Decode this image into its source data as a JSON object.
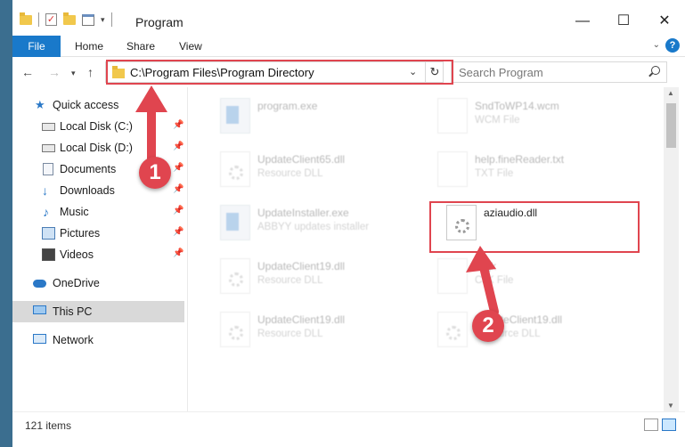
{
  "window": {
    "title": "Program"
  },
  "ribbon": {
    "tabs": [
      "File",
      "Home",
      "Share",
      "View"
    ],
    "help": "?"
  },
  "address": {
    "path": "C:\\Program Files\\Program Directory",
    "search_placeholder": "Search Program"
  },
  "nav": {
    "items": [
      {
        "label": "Quick access",
        "icon": "star-icon"
      },
      {
        "label": "Local Disk (C:)",
        "icon": "disk-icon",
        "pinned": true
      },
      {
        "label": "Local Disk (D:)",
        "icon": "disk-icon",
        "pinned": true
      },
      {
        "label": "Documents",
        "icon": "documents-icon",
        "pinned": true
      },
      {
        "label": "Downloads",
        "icon": "downloads-icon",
        "pinned": true
      },
      {
        "label": "Music",
        "icon": "music-icon",
        "pinned": true
      },
      {
        "label": "Pictures",
        "icon": "pictures-icon",
        "pinned": true
      },
      {
        "label": "Videos",
        "icon": "videos-icon",
        "pinned": true
      },
      {
        "label": "OneDrive",
        "icon": "cloud-icon"
      },
      {
        "label": "This PC",
        "icon": "pc-icon",
        "selected": true
      },
      {
        "label": "Network",
        "icon": "network-icon"
      }
    ]
  },
  "files": [
    {
      "name": "program.exe",
      "type": "",
      "icon": "exe"
    },
    {
      "name": "SndToWP14.wcm",
      "type": "WCM File",
      "icon": "txt"
    },
    {
      "name": "UpdateClient65.dll",
      "type": "Resource DLL",
      "icon": "dll"
    },
    {
      "name": "help.fineReader.txt",
      "type": "TXT File",
      "icon": "txt"
    },
    {
      "name": "UpdateInstaller.exe",
      "type": "ABBYY updates installer",
      "icon": "exe"
    },
    {
      "name": "aziaudio.dll",
      "type": "",
      "icon": "dll",
      "highlighted": true
    },
    {
      "name": "UpdateClient19.dll",
      "type": "Resource DLL",
      "icon": "dll"
    },
    {
      "name": "s.cjk",
      "type": "CJK File",
      "icon": "txt"
    },
    {
      "name": "UpdateClient19.dll",
      "type": "Resource DLL",
      "icon": "dll"
    },
    {
      "name": "UpdateClient19.dll",
      "type": "Resource DLL",
      "icon": "dll"
    }
  ],
  "status": {
    "item_count": "121 items"
  },
  "callouts": {
    "one": "1",
    "two": "2"
  },
  "colors": {
    "accent": "#1979ca",
    "highlight": "#e0454f",
    "selection": "#cce8ff"
  }
}
